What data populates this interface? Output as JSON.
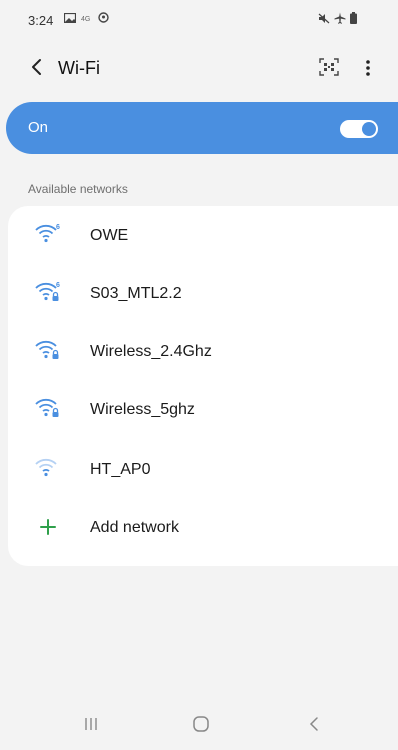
{
  "status_bar": {
    "time": "3:24",
    "left_icons": [
      "gallery-icon",
      "data-icon",
      "sync-icon"
    ],
    "right_icons": [
      "mute-icon",
      "airplane-icon",
      "battery-icon"
    ]
  },
  "app_bar": {
    "title": "Wi-Fi",
    "back_icon": "chevron-left-icon",
    "qr_icon": "qr-scan-icon",
    "more_icon": "more-vert-icon"
  },
  "wifi_toggle": {
    "label": "On",
    "checked": true,
    "color": "#4a8fe0"
  },
  "networks": {
    "header": "Available networks",
    "items": [
      {
        "name": "OWE",
        "icon": "wifi-6-icon",
        "secured": false
      },
      {
        "name": "S03_MTL2.2",
        "icon": "wifi-6-lock-icon",
        "secured": true
      },
      {
        "name": "Wireless_2.4Ghz",
        "icon": "wifi-lock-icon",
        "secured": true
      },
      {
        "name": "Wireless_5ghz",
        "icon": "wifi-lock-icon",
        "secured": true
      },
      {
        "name": "HT_AP0",
        "icon": "wifi-weak-icon",
        "secured": false
      }
    ],
    "add_network_label": "Add network",
    "add_icon": "plus-icon",
    "add_color": "#2fa04b"
  },
  "nav_bar": {
    "recents_icon": "recents-icon",
    "home_icon": "home-icon",
    "back_icon": "back-icon"
  }
}
